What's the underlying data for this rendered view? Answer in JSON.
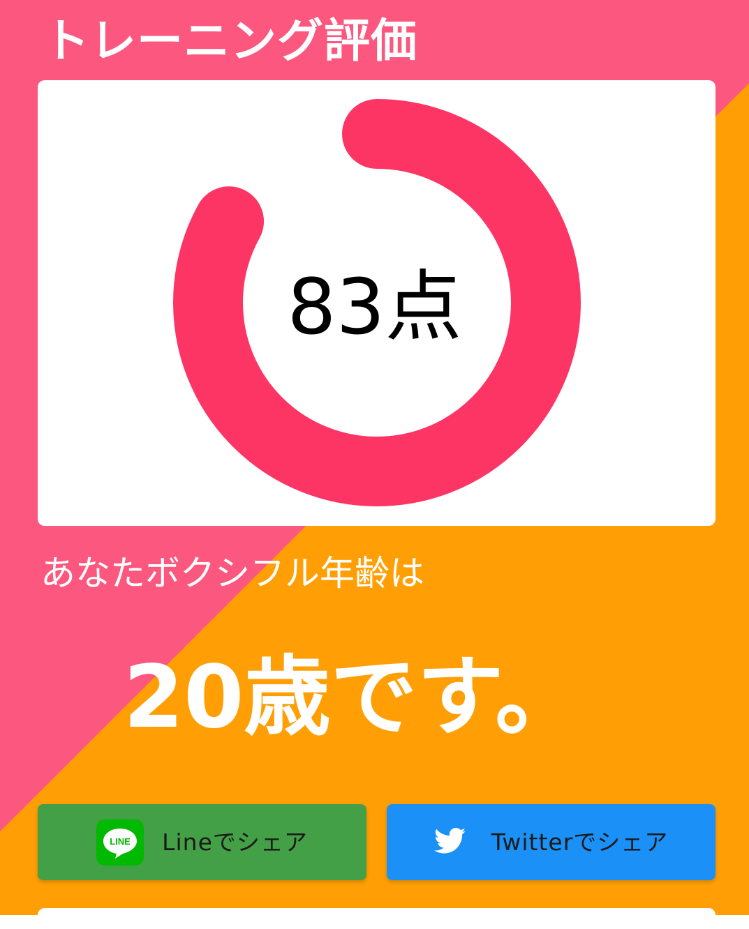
{
  "page": {
    "title": "トレーニング評価"
  },
  "score": {
    "value": 83,
    "unit": "点",
    "display": "83点",
    "ring_color": "#fc3565",
    "progress_fraction": 0.83
  },
  "age": {
    "label": "あなたボクシフル年齢は",
    "result": "20歳です。"
  },
  "share": {
    "line": {
      "label": "Lineでシェア",
      "icon": "line-logo-icon",
      "icon_text": "LINE",
      "color": "#43a047"
    },
    "twitter": {
      "label": "Twitterでシェア",
      "icon": "twitter-bird-icon",
      "color": "#1b91f8"
    }
  },
  "colors": {
    "background_pink": "#fc577e",
    "background_orange": "#ff9f05"
  }
}
